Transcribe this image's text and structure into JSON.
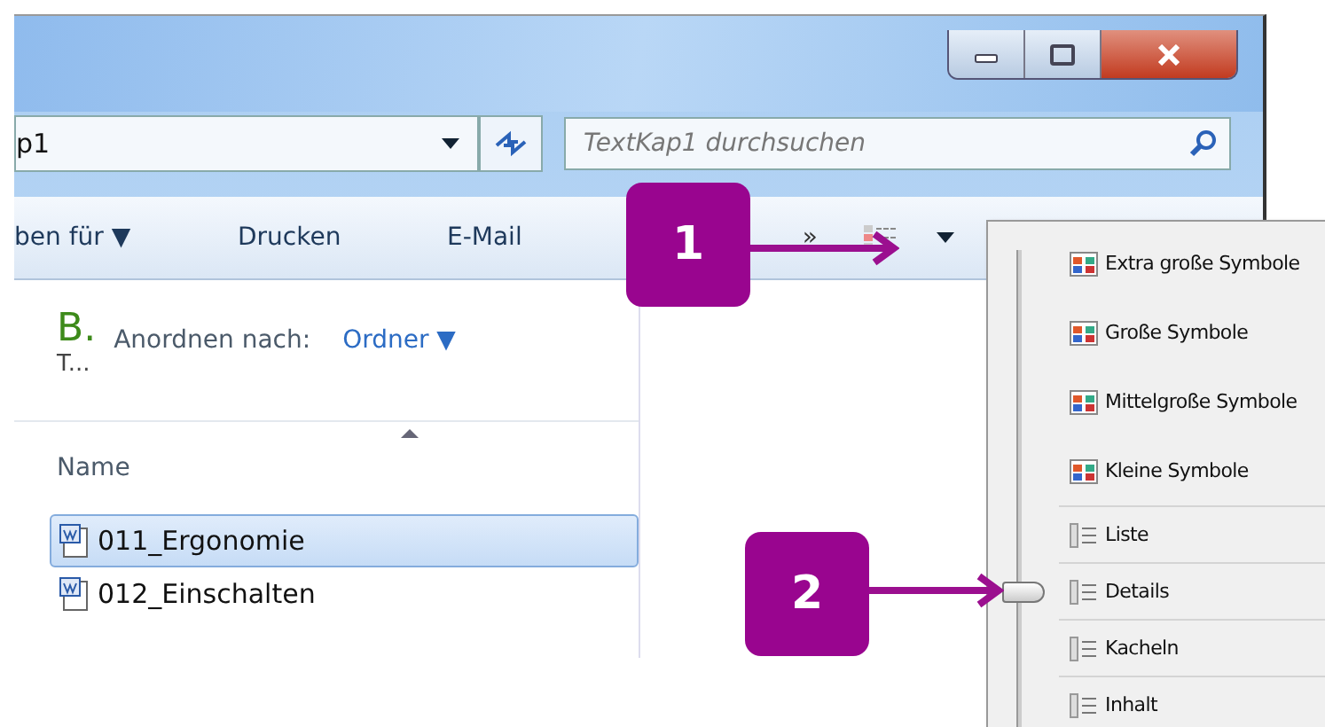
{
  "window": {
    "address": "p1",
    "search": {
      "placeholder": "TextKap1 durchsuchen"
    }
  },
  "toolbar": {
    "items": [
      "ben für ▼",
      "Drucken",
      "E-Mail",
      "»"
    ]
  },
  "pane": {
    "library_title": "B.",
    "library_subtitle": "T...",
    "arrange_label": "Anordnen nach:",
    "arrange_value": "Ordner ▼"
  },
  "file_list": {
    "columns": [
      "Name"
    ],
    "rows": [
      {
        "name": "011_Ergonomie",
        "selected": true
      },
      {
        "name": "012_Einschalten",
        "selected": false
      }
    ]
  },
  "view_menu": {
    "items": [
      {
        "label": "Extra große Symbole",
        "kind": "size",
        "selected": false
      },
      {
        "label": "Große Symbole",
        "kind": "size",
        "selected": false
      },
      {
        "label": "Mittelgroße Symbole",
        "kind": "size",
        "selected": false
      },
      {
        "label": "Kleine Symbole",
        "kind": "size",
        "selected": false
      },
      {
        "label": "Liste",
        "kind": "layout",
        "selected": false
      },
      {
        "label": "Details",
        "kind": "layout",
        "selected": true
      },
      {
        "label": "Kacheln",
        "kind": "layout",
        "selected": false
      },
      {
        "label": "Inhalt",
        "kind": "layout",
        "selected": false
      }
    ]
  },
  "callouts": [
    {
      "number": "1"
    },
    {
      "number": "2"
    }
  ]
}
